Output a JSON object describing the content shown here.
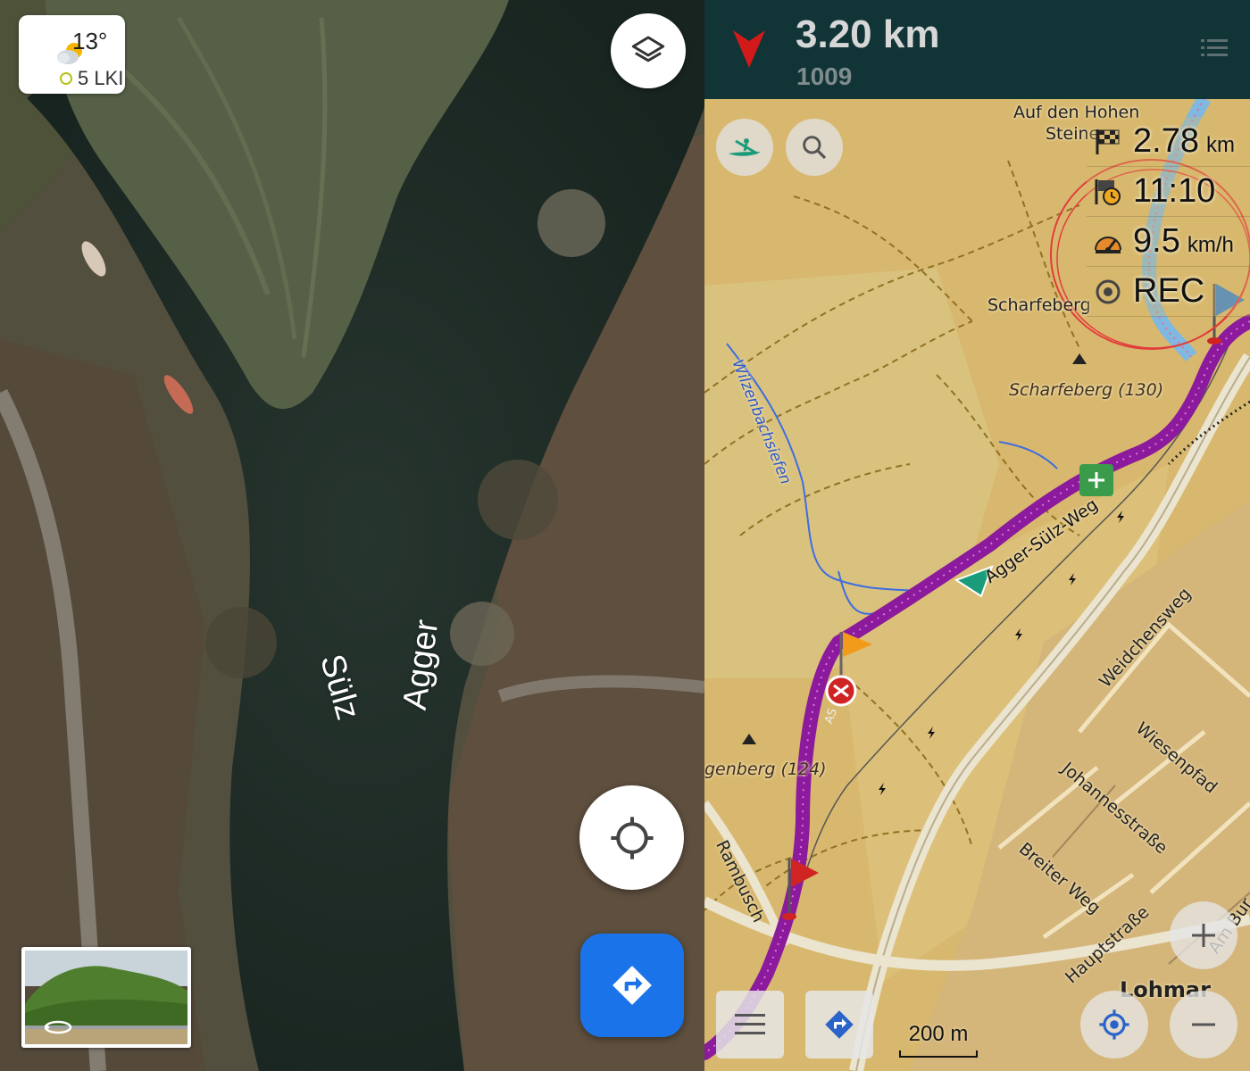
{
  "left_map": {
    "weather": {
      "temperature": "13°",
      "air_quality": "5 LKI"
    },
    "river_labels": {
      "sulz": "Sülz",
      "agger": "Agger"
    },
    "buttons": {
      "layers_icon": "layers-icon",
      "locate_icon": "my-location-icon",
      "directions_icon": "directions-icon"
    },
    "colors": {
      "directions_button": "#1a73e8"
    }
  },
  "right_map": {
    "top_bar": {
      "distance": "3.20 km",
      "street": "1009"
    },
    "widgets": [
      {
        "icon": "finish-flag-icon",
        "value": "2.78",
        "unit": "km"
      },
      {
        "icon": "arrival-time-icon",
        "value": "11:10",
        "unit": ""
      },
      {
        "icon": "speed-icon",
        "value": "9.5",
        "unit": "km/h"
      },
      {
        "icon": "record-icon",
        "value": "REC",
        "unit": ""
      }
    ],
    "labels": {
      "auf_den_hohen_steine_1": "Auf den Hohen",
      "auf_den_hohen_steine_2": "Steine",
      "scharfeberg": "Scharfeberg",
      "scharfeberg_peak": "Scharfeberg (130)",
      "wilzenbachsiefen": "Wilzenbachsiefen",
      "agger_sulz_weg": "Agger-Sülz-Weg",
      "weidchensweg": "Weidchensweg",
      "wiesenpfad": "Wiesenpfad",
      "johannesstrasse": "Johannesstraße",
      "breiter_weg": "Breiter Weg",
      "hauptstrasse": "Hauptstraße",
      "genberg": "genberg (124)",
      "rambusch": "Rambusch",
      "lohmar": "Lohmar",
      "am_burg": "Am Bur",
      "route_tag": "AS"
    },
    "scale": "200 m",
    "colors": {
      "top_bar": "#113437",
      "route": "#8b1a9c",
      "map_base": "#d8b86e",
      "annotation_circle": "#e33b3b"
    }
  }
}
